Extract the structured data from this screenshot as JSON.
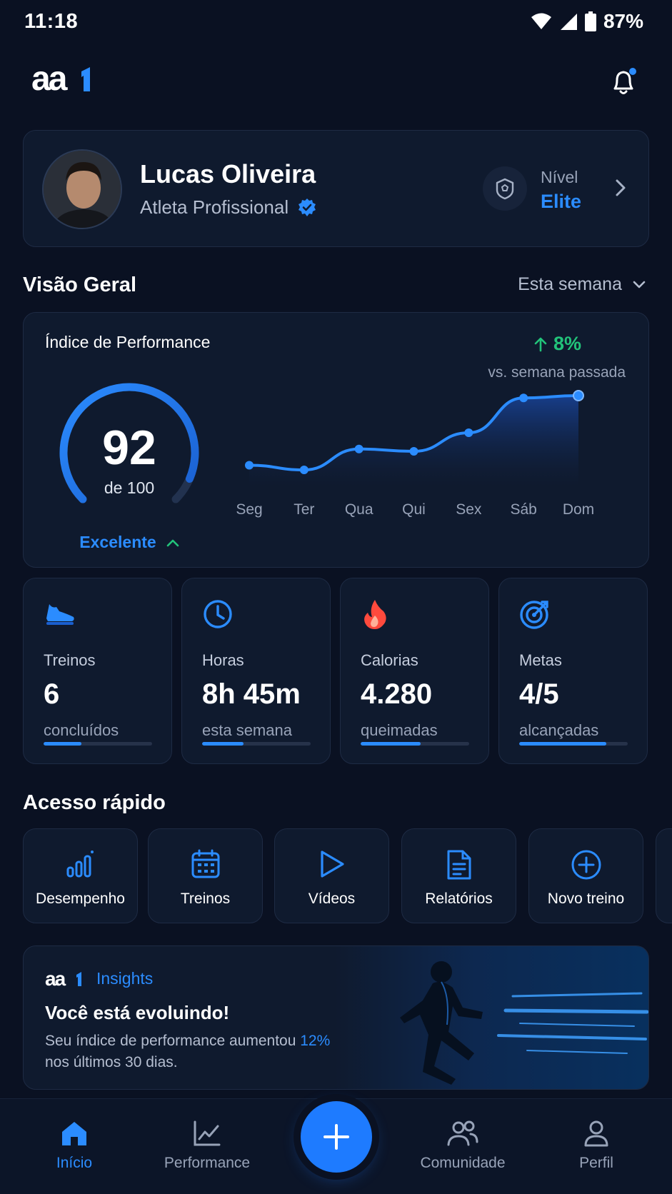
{
  "status_bar": {
    "time": "11:18",
    "battery": "87%"
  },
  "header": {
    "logo_text": "aa1",
    "notification_dot": true
  },
  "profile": {
    "name": "Lucas Oliveira",
    "role": "Atleta Profissional",
    "level_label": "Nível",
    "level_value": "Elite"
  },
  "overview": {
    "title": "Visão Geral",
    "period": "Esta semana"
  },
  "performance": {
    "title": "Índice de Performance",
    "delta": "8%",
    "delta_caption": "vs. semana passada",
    "score": "92",
    "score_max": "de 100",
    "score_fraction": 0.92,
    "rating": "Excelente"
  },
  "chart_data": {
    "type": "area",
    "categories": [
      "Seg",
      "Ter",
      "Qua",
      "Qui",
      "Sex",
      "Sáb",
      "Dom"
    ],
    "values": [
      62,
      60,
      69,
      68,
      76,
      91,
      92
    ],
    "ylim": [
      40,
      100
    ],
    "grid": false
  },
  "stats": [
    {
      "icon": "shoe-icon",
      "label": "Treinos",
      "value": "6",
      "sub": "concluídos",
      "progress": 0.35
    },
    {
      "icon": "clock-icon",
      "label": "Horas",
      "value": "8h 45m",
      "sub": "esta semana",
      "progress": 0.38
    },
    {
      "icon": "flame-icon",
      "label": "Calorias",
      "value": "4.280",
      "sub": "queimadas",
      "progress": 0.55
    },
    {
      "icon": "target-icon",
      "label": "Metas",
      "value": "4/5",
      "sub": "alcançadas",
      "progress": 0.8
    }
  ],
  "quick_access": {
    "title": "Acesso rápido",
    "items": [
      {
        "icon": "bar-chart-icon",
        "label": "Desempenho"
      },
      {
        "icon": "calendar-icon",
        "label": "Treinos"
      },
      {
        "icon": "play-icon",
        "label": "Vídeos"
      },
      {
        "icon": "document-icon",
        "label": "Relatórios"
      },
      {
        "icon": "plus-circle-icon",
        "label": "Novo treino"
      }
    ]
  },
  "insights": {
    "brand": "aa1",
    "label": "Insights",
    "title": "Você está evoluindo!",
    "text_before": "Seu índice de performance aumentou ",
    "highlight": "12%",
    "text_after": " nos últimos 30 dias."
  },
  "bottom_nav": {
    "items": [
      {
        "icon": "home-icon",
        "label": "Início",
        "active": true
      },
      {
        "icon": "line-chart-icon",
        "label": "Performance",
        "active": false
      },
      {
        "icon": "community-icon",
        "label": "Comunidade",
        "active": false
      },
      {
        "icon": "user-icon",
        "label": "Perfil",
        "active": false
      }
    ]
  },
  "colors": {
    "accent": "#2b8cff",
    "positive": "#22c37a",
    "flame": "#ff4a3d",
    "background": "#0a1122"
  }
}
